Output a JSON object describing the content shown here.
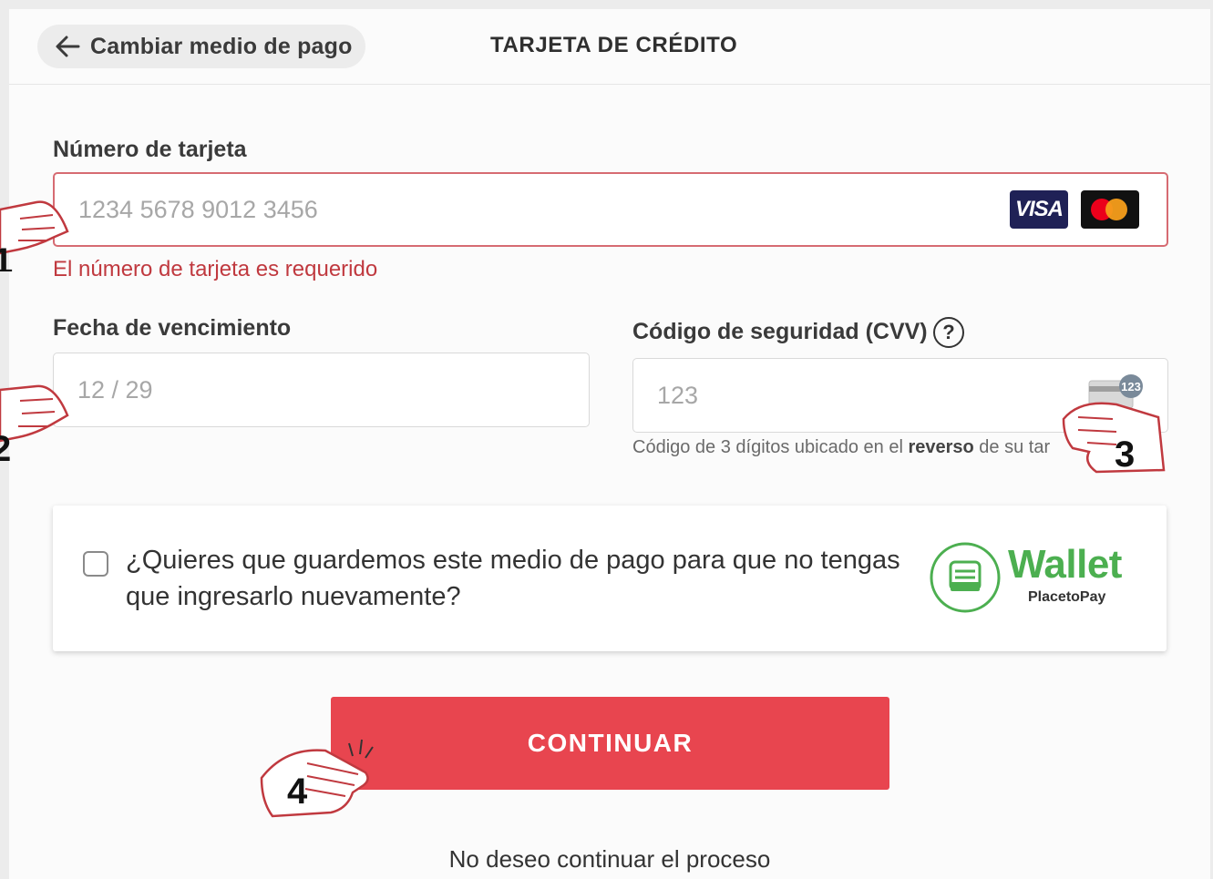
{
  "header": {
    "back_label": "Cambiar medio de pago",
    "title": "TARJETA DE CRÉDITO"
  },
  "card_number": {
    "label": "Número de tarjeta",
    "placeholder": "1234 5678 9012 3456",
    "error": "El número de tarjeta es requerido",
    "brands": [
      "VISA",
      "Mastercard"
    ]
  },
  "expiry": {
    "label": "Fecha de vencimiento",
    "placeholder": "12 / 29"
  },
  "cvv": {
    "label": "Código de seguridad (CVV)",
    "help_symbol": "?",
    "placeholder": "123",
    "hint_prefix": "Código de 3 dígitos ubicado en el ",
    "hint_bold": "reverso",
    "hint_suffix": " de su tar"
  },
  "save_option": {
    "text": "¿Quieres que guardemos este medio de pago para que no tengas que ingresarlo nuevamente?",
    "checked": false,
    "logo_title": "Wallet",
    "logo_subtitle": "PlacetoPay"
  },
  "actions": {
    "continue_label": "CONTINUAR",
    "cancel_label": "No deseo continuar el proceso"
  },
  "annotations": {
    "steps": [
      "1",
      "2",
      "3",
      "4"
    ]
  },
  "colors": {
    "accent": "#e8454f",
    "error": "#c0393f",
    "wallet_green": "#4caf50",
    "visa_navy": "#1f2156"
  }
}
